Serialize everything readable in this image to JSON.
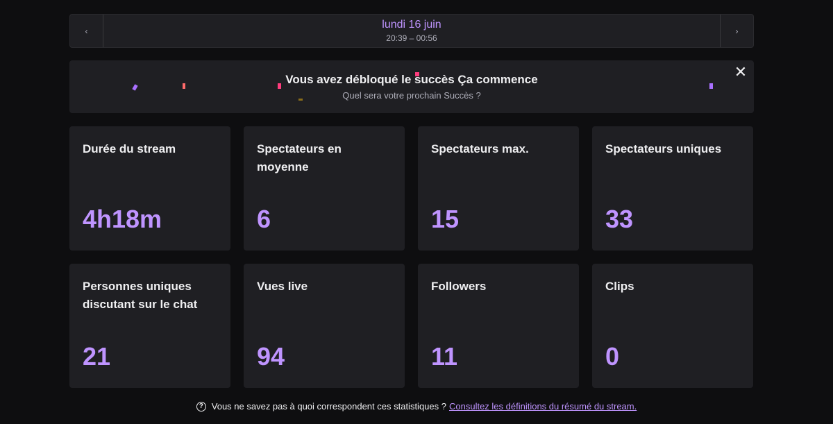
{
  "date_nav": {
    "prev_icon": "chevron-left-icon",
    "next_icon": "chevron-right-icon",
    "prev_glyph": "‹",
    "next_glyph": "›",
    "date": "lundi 16 juin",
    "time_range": "20:39 – 00:56"
  },
  "banner": {
    "title": "Vous avez débloqué le succès Ça commence",
    "subtitle": "Quel sera votre prochain Succès ?",
    "close_glyph": "✕"
  },
  "stats": [
    {
      "label": "Durée du stream",
      "value": "4h18m"
    },
    {
      "label": "Spectateurs en moyenne",
      "value": "6"
    },
    {
      "label": "Spectateurs max.",
      "value": "15"
    },
    {
      "label": "Spectateurs uniques",
      "value": "33"
    },
    {
      "label": "Personnes uniques discutant sur le chat",
      "value": "21"
    },
    {
      "label": "Vues live",
      "value": "94"
    },
    {
      "label": "Followers",
      "value": "11"
    },
    {
      "label": "Clips",
      "value": "0"
    }
  ],
  "footer": {
    "help_glyph": "?",
    "text": "Vous ne savez pas à quoi correspondent ces statistiques ?",
    "link": "Consultez les définitions du résumé du stream."
  },
  "colors": {
    "accent": "#bf94ff",
    "background": "#0e0e10",
    "card": "#1f1f23"
  }
}
